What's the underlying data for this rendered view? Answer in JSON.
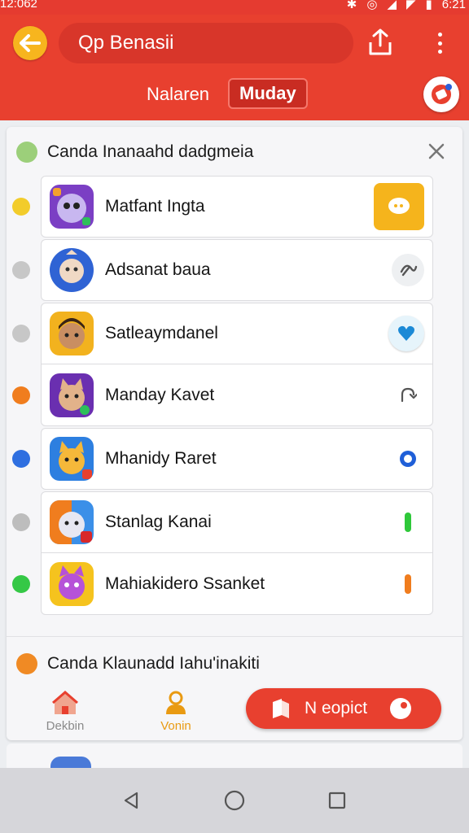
{
  "status_bar": {
    "time": "12:062",
    "clock_right": "6:21"
  },
  "header": {
    "search_text": "Qp Benasii",
    "tab_inactive": "Nalaren",
    "tab_active": "Muday"
  },
  "card": {
    "title": "Canda Inanaahd dadgmeia",
    "items": [
      {
        "name": "Matfant Ingta",
        "dot_color": "#f2cc2b",
        "trail": "chat-bubble-icon"
      },
      {
        "name": "Adsanat baua",
        "dot_color": "#c7c7c7",
        "trail": "link-icon"
      },
      {
        "name": "Satleaymdanel",
        "dot_color": "#c7c7c7",
        "trail": "heart-badge-icon"
      },
      {
        "name": "Manday Kavet",
        "dot_color": "#f07d1e",
        "trail": "refresh-icon"
      },
      {
        "name": "Mhanidy Raret",
        "dot_color": "#2f6fe0",
        "trail": "blue-ring-icon"
      },
      {
        "name": "Stanlag Kanai",
        "dot_color": "#bdbdbd",
        "trail": "green-bar-icon"
      },
      {
        "name": "Mahiakidero Ssanket",
        "dot_color": "#35c846",
        "trail": "orange-bar-icon"
      }
    ],
    "footer_title": "Canda Klaunadd Iahu'inakiti",
    "nav": [
      {
        "label": "Dekbin",
        "color": "#8a8a8a"
      },
      {
        "label": "Vonin",
        "color": "#e99a12"
      }
    ],
    "cta_label": "N eopict"
  },
  "colors": {
    "brand": "#e8402f",
    "accent_yellow": "#f7b51e"
  }
}
